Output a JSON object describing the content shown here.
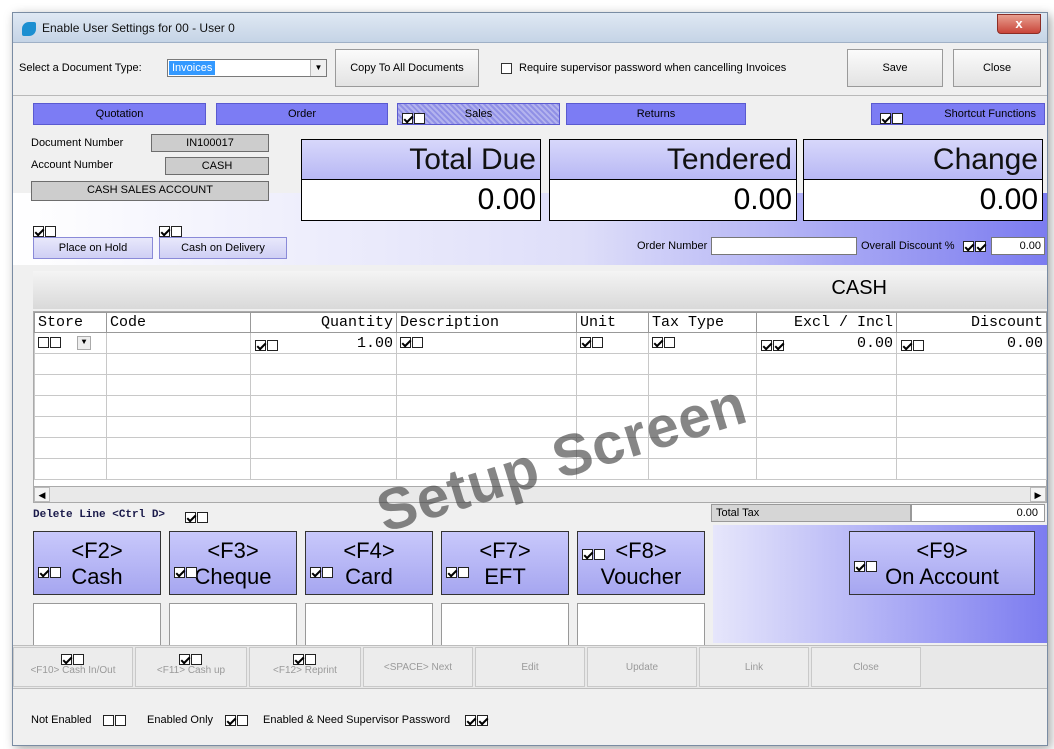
{
  "window": {
    "title": "Enable User Settings for 00 - User 0",
    "close_glyph": "x"
  },
  "toolbar": {
    "doc_type_label": "Select a Document Type:",
    "doc_type_value": "Invoices",
    "copy_label": "Copy To All Documents",
    "require_label": "Require supervisor password when cancelling Invoices",
    "save_label": "Save",
    "close_label": "Close"
  },
  "tabs": {
    "quotation": "Quotation",
    "order": "Order",
    "sales": "Sales",
    "returns": "Returns",
    "shortcut": "Shortcut Functions"
  },
  "info": {
    "doc_number_label": "Document Number",
    "doc_number_value": "IN100017",
    "account_number_label": "Account Number",
    "account_number_value": "CASH",
    "account_name": "CASH SALES ACCOUNT"
  },
  "totals": {
    "total_due_label": "Total Due",
    "total_due_value": "0.00",
    "tendered_label": "Tendered",
    "tendered_value": "0.00",
    "change_label": "Change",
    "change_value": "0.00"
  },
  "options": {
    "place_on_hold": "Place on Hold",
    "cash_on_delivery": "Cash on Delivery",
    "order_number_label": "Order Number",
    "overall_discount_label": "Overall Discount %",
    "overall_discount_value": "0.00"
  },
  "account_banner": "CASH",
  "grid": {
    "columns": [
      "Store",
      "Code",
      "Quantity",
      "Description",
      "Unit",
      "Tax Type",
      "Excl / Incl",
      "Discount"
    ],
    "row1": {
      "quantity": "1.00",
      "excl_incl": "0.00",
      "discount": "0.00"
    }
  },
  "delete_line_label": "Delete Line <Ctrl D>",
  "total_tax_label": "Total Tax",
  "total_tax_value": "0.00",
  "payments": [
    {
      "key": "<F2>",
      "label": "Cash"
    },
    {
      "key": "<F3>",
      "label": "Cheque"
    },
    {
      "key": "<F4>",
      "label": "Card"
    },
    {
      "key": "<F7>",
      "label": "EFT"
    },
    {
      "key": "<F8>",
      "label": "Voucher"
    },
    {
      "key": "<F9>",
      "label": "On Account"
    }
  ],
  "bottom_buttons": [
    "<F10> Cash In/Out",
    "<F11> Cash up",
    "<F12> Reprint",
    "<SPACE> Next",
    "Edit",
    "Update",
    "Link",
    "Close"
  ],
  "legend": {
    "not_enabled": "Not Enabled",
    "enabled_only": "Enabled Only",
    "enabled_need_password": "Enabled & Need Supervisor Password"
  },
  "watermark": "Setup Screen",
  "colors": {
    "accent_purple": "#7c7cf4",
    "panel_lavender": "#c8c8fb",
    "selection_blue": "#3399ff"
  }
}
